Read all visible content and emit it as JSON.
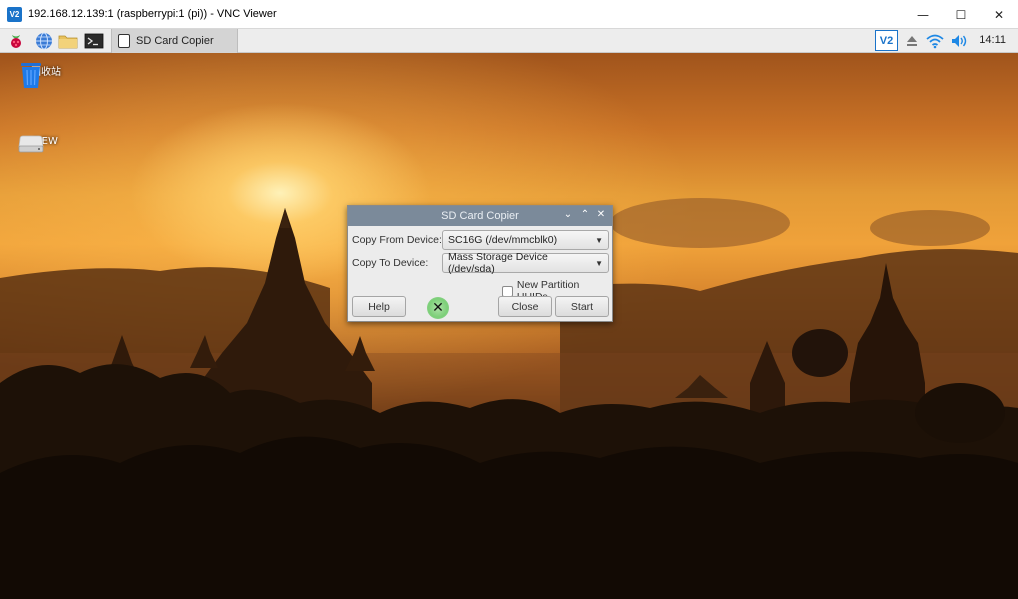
{
  "vnc_window": {
    "logo_text": "V2",
    "title": "192.168.12.139:1 (raspberrypi:1 (pi)) - VNC Viewer",
    "minimize_glyph": "—",
    "maximize_glyph": "☐",
    "close_glyph": "✕"
  },
  "pi_panel": {
    "launchers": [
      "raspberry-menu-icon",
      "web-browser-icon",
      "file-manager-icon",
      "terminal-icon"
    ],
    "taskbar_item_label": "SD Card Copier",
    "tray": {
      "vnc_label": "V2",
      "icons": [
        "eject-icon",
        "wifi-icon",
        "volume-icon"
      ]
    },
    "clock": "14:11"
  },
  "desktop": {
    "icons": [
      {
        "label": "回收站",
        "icon": "trash-icon"
      },
      {
        "label": "NEW",
        "icon": "drive-icon"
      }
    ]
  },
  "dialog": {
    "title": "SD Card Copier",
    "copy_from_label": "Copy From Device:",
    "copy_from_value": "SC16G  (/dev/mmcblk0)",
    "copy_to_label": "Copy To Device:",
    "copy_to_value": "Mass Storage Device  (/dev/sda)",
    "new_partition_label": "New Partition UUIDs",
    "new_partition_checked": false,
    "help_label": "Help",
    "close_label": "Close",
    "start_label": "Start"
  },
  "colors": {
    "dialog_title_bar": "#7b8a9a",
    "vnc_accent": "#1a73c9"
  }
}
